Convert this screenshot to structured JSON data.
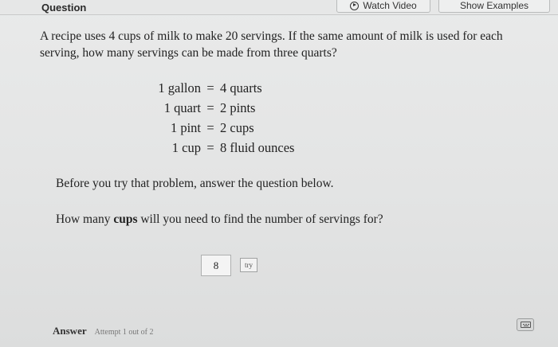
{
  "header": {
    "title": "Question",
    "watch_video_label": "Watch Video",
    "show_examples_label": "Show Examples"
  },
  "problem": {
    "text": "A recipe uses 4 cups of milk to make 20 servings. If the same amount of milk is used for each serving, how many servings can be made from three quarts?"
  },
  "conversions": [
    {
      "left": "1 gallon",
      "eq": "=",
      "right": "4 quarts"
    },
    {
      "left": "1 quart",
      "eq": "=",
      "right": "2 pints"
    },
    {
      "left": "1 pint",
      "eq": "=",
      "right": "2 cups"
    },
    {
      "left": "1 cup",
      "eq": "=",
      "right": "8 fluid ounces"
    }
  ],
  "instruction": "Before you try that problem, answer the question below.",
  "question": {
    "before": "How many ",
    "bold": "cups",
    "after": " will you need to find the number of servings for?"
  },
  "answer_input": {
    "value": "8"
  },
  "try_label": "try",
  "footer": {
    "answer_label": "Answer",
    "attempt_text": "Attempt 1 out of 2"
  },
  "icons": {
    "play": "play-circle-icon",
    "keyboard": "keyboard-icon"
  }
}
